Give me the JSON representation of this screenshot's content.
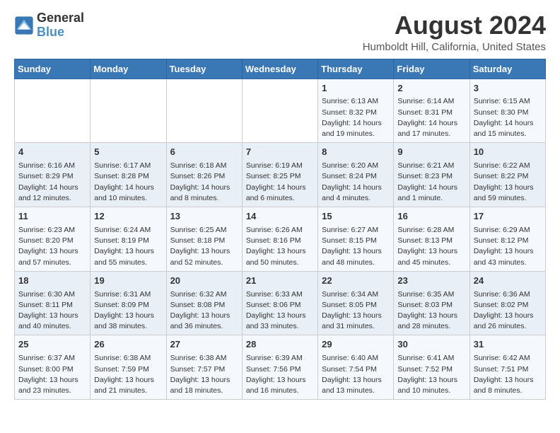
{
  "header": {
    "logo_line1": "General",
    "logo_line2": "Blue",
    "title": "August 2024",
    "subtitle": "Humboldt Hill, California, United States"
  },
  "calendar": {
    "weekdays": [
      "Sunday",
      "Monday",
      "Tuesday",
      "Wednesday",
      "Thursday",
      "Friday",
      "Saturday"
    ],
    "rows": [
      [
        {
          "day": "",
          "text": ""
        },
        {
          "day": "",
          "text": ""
        },
        {
          "day": "",
          "text": ""
        },
        {
          "day": "",
          "text": ""
        },
        {
          "day": "1",
          "text": "Sunrise: 6:13 AM\nSunset: 8:32 PM\nDaylight: 14 hours\nand 19 minutes."
        },
        {
          "day": "2",
          "text": "Sunrise: 6:14 AM\nSunset: 8:31 PM\nDaylight: 14 hours\nand 17 minutes."
        },
        {
          "day": "3",
          "text": "Sunrise: 6:15 AM\nSunset: 8:30 PM\nDaylight: 14 hours\nand 15 minutes."
        }
      ],
      [
        {
          "day": "4",
          "text": "Sunrise: 6:16 AM\nSunset: 8:29 PM\nDaylight: 14 hours\nand 12 minutes."
        },
        {
          "day": "5",
          "text": "Sunrise: 6:17 AM\nSunset: 8:28 PM\nDaylight: 14 hours\nand 10 minutes."
        },
        {
          "day": "6",
          "text": "Sunrise: 6:18 AM\nSunset: 8:26 PM\nDaylight: 14 hours\nand 8 minutes."
        },
        {
          "day": "7",
          "text": "Sunrise: 6:19 AM\nSunset: 8:25 PM\nDaylight: 14 hours\nand 6 minutes."
        },
        {
          "day": "8",
          "text": "Sunrise: 6:20 AM\nSunset: 8:24 PM\nDaylight: 14 hours\nand 4 minutes."
        },
        {
          "day": "9",
          "text": "Sunrise: 6:21 AM\nSunset: 8:23 PM\nDaylight: 14 hours\nand 1 minute."
        },
        {
          "day": "10",
          "text": "Sunrise: 6:22 AM\nSunset: 8:22 PM\nDaylight: 13 hours\nand 59 minutes."
        }
      ],
      [
        {
          "day": "11",
          "text": "Sunrise: 6:23 AM\nSunset: 8:20 PM\nDaylight: 13 hours\nand 57 minutes."
        },
        {
          "day": "12",
          "text": "Sunrise: 6:24 AM\nSunset: 8:19 PM\nDaylight: 13 hours\nand 55 minutes."
        },
        {
          "day": "13",
          "text": "Sunrise: 6:25 AM\nSunset: 8:18 PM\nDaylight: 13 hours\nand 52 minutes."
        },
        {
          "day": "14",
          "text": "Sunrise: 6:26 AM\nSunset: 8:16 PM\nDaylight: 13 hours\nand 50 minutes."
        },
        {
          "day": "15",
          "text": "Sunrise: 6:27 AM\nSunset: 8:15 PM\nDaylight: 13 hours\nand 48 minutes."
        },
        {
          "day": "16",
          "text": "Sunrise: 6:28 AM\nSunset: 8:13 PM\nDaylight: 13 hours\nand 45 minutes."
        },
        {
          "day": "17",
          "text": "Sunrise: 6:29 AM\nSunset: 8:12 PM\nDaylight: 13 hours\nand 43 minutes."
        }
      ],
      [
        {
          "day": "18",
          "text": "Sunrise: 6:30 AM\nSunset: 8:11 PM\nDaylight: 13 hours\nand 40 minutes."
        },
        {
          "day": "19",
          "text": "Sunrise: 6:31 AM\nSunset: 8:09 PM\nDaylight: 13 hours\nand 38 minutes."
        },
        {
          "day": "20",
          "text": "Sunrise: 6:32 AM\nSunset: 8:08 PM\nDaylight: 13 hours\nand 36 minutes."
        },
        {
          "day": "21",
          "text": "Sunrise: 6:33 AM\nSunset: 8:06 PM\nDaylight: 13 hours\nand 33 minutes."
        },
        {
          "day": "22",
          "text": "Sunrise: 6:34 AM\nSunset: 8:05 PM\nDaylight: 13 hours\nand 31 minutes."
        },
        {
          "day": "23",
          "text": "Sunrise: 6:35 AM\nSunset: 8:03 PM\nDaylight: 13 hours\nand 28 minutes."
        },
        {
          "day": "24",
          "text": "Sunrise: 6:36 AM\nSunset: 8:02 PM\nDaylight: 13 hours\nand 26 minutes."
        }
      ],
      [
        {
          "day": "25",
          "text": "Sunrise: 6:37 AM\nSunset: 8:00 PM\nDaylight: 13 hours\nand 23 minutes."
        },
        {
          "day": "26",
          "text": "Sunrise: 6:38 AM\nSunset: 7:59 PM\nDaylight: 13 hours\nand 21 minutes."
        },
        {
          "day": "27",
          "text": "Sunrise: 6:38 AM\nSunset: 7:57 PM\nDaylight: 13 hours\nand 18 minutes."
        },
        {
          "day": "28",
          "text": "Sunrise: 6:39 AM\nSunset: 7:56 PM\nDaylight: 13 hours\nand 16 minutes."
        },
        {
          "day": "29",
          "text": "Sunrise: 6:40 AM\nSunset: 7:54 PM\nDaylight: 13 hours\nand 13 minutes."
        },
        {
          "day": "30",
          "text": "Sunrise: 6:41 AM\nSunset: 7:52 PM\nDaylight: 13 hours\nand 10 minutes."
        },
        {
          "day": "31",
          "text": "Sunrise: 6:42 AM\nSunset: 7:51 PM\nDaylight: 13 hours\nand 8 minutes."
        }
      ]
    ]
  }
}
